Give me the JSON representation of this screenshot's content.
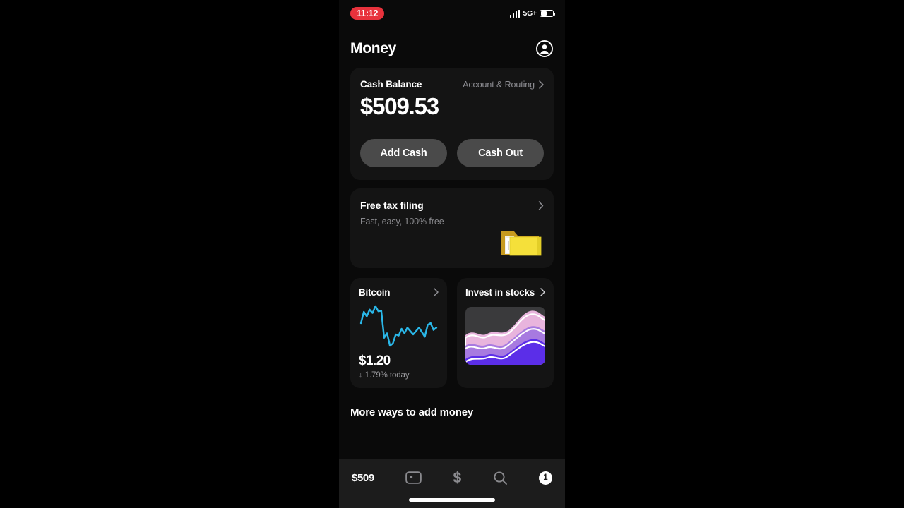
{
  "status_bar": {
    "time": "11:12",
    "time_pill_color": "#e8323c",
    "network": "5G+",
    "signal_icon": "cellular-signal-icon",
    "battery_icon": "battery-icon"
  },
  "header": {
    "title": "Money",
    "account_icon": "account-avatar-icon"
  },
  "balance_card": {
    "label": "Cash Balance",
    "account_routing_label": "Account & Routing",
    "chevron_icon": "chevron-right-icon",
    "amount": "$509.53",
    "add_cash_label": "Add Cash",
    "cash_out_label": "Cash Out",
    "button_color": "#4a4a4a"
  },
  "tax_card": {
    "title": "Free tax filing",
    "subtitle": "Fast, easy, 100% free",
    "chevron_icon": "chevron-right-icon",
    "illustration_icon": "yellow-folder-icon",
    "folder_color": "#f5e03a"
  },
  "bitcoin_card": {
    "title": "Bitcoin",
    "chevron_icon": "chevron-right-icon",
    "price": "$1.20",
    "change": "1.79% today",
    "change_arrow": "↓",
    "line_color": "#2ab7e8",
    "direction": "down"
  },
  "stocks_card": {
    "title": "Invest in stocks",
    "chevron_icon": "chevron-right-icon",
    "illustration_icon": "stocks-area-chart-icon",
    "tile_color": "#3a3a3c",
    "band_colors": [
      "#e8b4dd",
      "#a77ae0",
      "#5b2ee8"
    ]
  },
  "more_section": {
    "heading": "More ways to add money"
  },
  "tab_bar": {
    "tabs": [
      {
        "label": "$509",
        "icon": "money-tab-icon",
        "active": true
      },
      {
        "label": "",
        "icon": "cash-card-icon",
        "active": false
      },
      {
        "label": "$",
        "icon": "dollar-payment-icon",
        "active": false
      },
      {
        "label": "",
        "icon": "search-icon",
        "active": false
      },
      {
        "label": "1",
        "icon": "activity-badge-icon",
        "active": false
      }
    ],
    "home_indicator": "home-indicator"
  },
  "chart_data": {
    "type": "line",
    "title": "Bitcoin",
    "series": [
      {
        "name": "Bitcoin price",
        "color": "#2ab7e8",
        "values": [
          52,
          32,
          40,
          28,
          34,
          22,
          31,
          30,
          78,
          70,
          92,
          88,
          72,
          74,
          62,
          70,
          60,
          66,
          72,
          66,
          60,
          68,
          76,
          55,
          52,
          64,
          60
        ]
      }
    ],
    "ylabel": "",
    "xlabel": "",
    "grid": false,
    "legend": "none",
    "annotations": [
      "$1.20",
      "↓ 1.79% today"
    ]
  }
}
